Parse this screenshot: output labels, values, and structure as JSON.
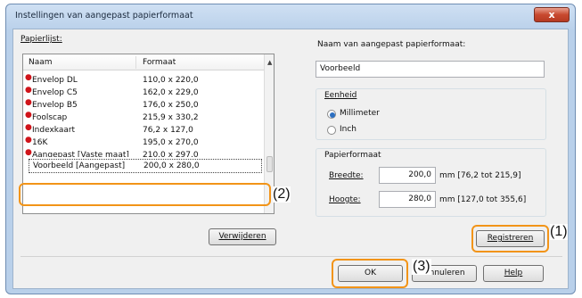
{
  "window": {
    "title": "Instellingen van aangepast papierformaat",
    "close_label": "x"
  },
  "paper_list": {
    "label": "Papierlijst:",
    "columns": [
      "Naam",
      "Formaat"
    ],
    "rows": [
      {
        "name": "Envelop DL",
        "size": "110,0 x 220,0",
        "marked": true
      },
      {
        "name": "Envelop C5",
        "size": "162,0 x 229,0",
        "marked": true
      },
      {
        "name": "Envelop B5",
        "size": "176,0 x 250,0",
        "marked": true
      },
      {
        "name": "Foolscap",
        "size": "215,9 x 330,2",
        "marked": true
      },
      {
        "name": "Indexkaart",
        "size": "76,2 x 127,0",
        "marked": true
      },
      {
        "name": "16K",
        "size": "195,0 x 270,0",
        "marked": true
      },
      {
        "name": "Aangepast [Vaste maat]",
        "size": "210,0 x 297,0",
        "marked": true
      }
    ],
    "selected_row": {
      "name": "Voorbeeld [Aangepast]",
      "size": "200,0 x 280,0"
    },
    "delete_button": "Verwijderen"
  },
  "custom_name": {
    "label": "Naam van aangepast papierformaat:",
    "value": "Voorbeeld"
  },
  "unit": {
    "label": "Eenheid",
    "options": [
      {
        "label": "Millimeter",
        "selected": true
      },
      {
        "label": "Inch",
        "selected": false
      }
    ]
  },
  "paper_size": {
    "label": "Papierformaat",
    "width_label": "Breedte:",
    "width_value": "200,0",
    "width_range": "mm [76,2 tot 215,9]",
    "height_label": "Hoogte:",
    "height_value": "280,0",
    "height_range": "mm [127,0 tot 355,6]"
  },
  "buttons": {
    "register": "Registreren",
    "ok": "OK",
    "cancel": "Annuleren",
    "help": "Help"
  },
  "callouts": {
    "c1": "(1)",
    "c2": "(2)",
    "c3": "(3)"
  },
  "colors": {
    "highlight": "#f29418",
    "radio_accent": "#2c6fc1",
    "required_marker": "#d0141a"
  }
}
